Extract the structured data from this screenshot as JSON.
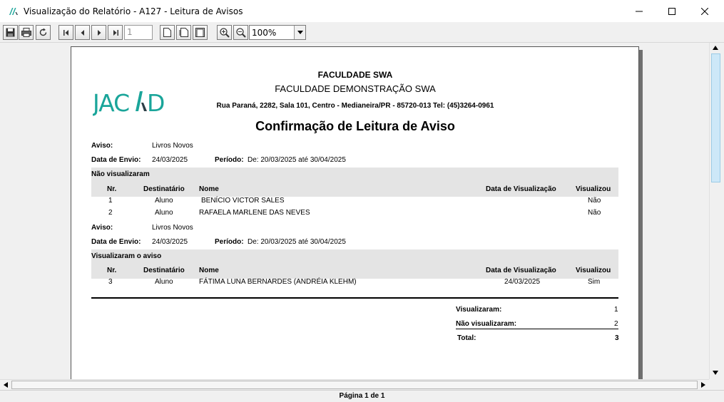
{
  "window": {
    "title": "Visualização do Relatório - A127 - Leitura de Avisos"
  },
  "toolbar": {
    "page_number": "1",
    "zoom": "100%"
  },
  "report": {
    "institution": "FACULDADE SWA",
    "subtitle": "FACULDADE DEMONSTRAÇÃO SWA",
    "address": "Rua Paraná, 2282, Sala 101, Centro - Medianeira/PR - 85720-013 Tel: (45)3264-0961",
    "title": "Confirmação de Leitura de Aviso",
    "logo_text": "JACAD",
    "labels": {
      "aviso": "Aviso:",
      "data_envio": "Data de Envio:",
      "periodo": "Período:"
    },
    "columns": [
      "Nr.",
      "Destinatário",
      "Nome",
      "Data de Visualização",
      "Visualizou"
    ],
    "sections": [
      {
        "aviso": "Livros Novos",
        "data_envio": "24/03/2025",
        "periodo": "De: 20/03/2025 até 30/04/2025",
        "group_title": "Não visualizaram",
        "rows": [
          {
            "nr": "1",
            "destinatario": "Aluno",
            "nome": "BENÍCIO VICTOR SALES",
            "data": "",
            "visualizou": "Não"
          },
          {
            "nr": "2",
            "destinatario": "Aluno",
            "nome": "RAFAELA MARLENE DAS NEVES",
            "data": "",
            "visualizou": "Não"
          }
        ]
      },
      {
        "aviso": "Livros Novos",
        "data_envio": "24/03/2025",
        "periodo": "De: 20/03/2025 até 30/04/2025",
        "group_title": "Visualizaram o aviso",
        "rows": [
          {
            "nr": "3",
            "destinatario": "Aluno",
            "nome": "FÁTIMA LUNA BERNARDES (ANDRÉIA KLEHM)",
            "data": "24/03/2025",
            "visualizou": "Sim"
          }
        ]
      }
    ],
    "summary": {
      "visualizaram_label": "Visualizaram:",
      "visualizaram": "1",
      "nao_visualizaram_label": "Não visualizaram:",
      "nao_visualizaram": "2",
      "total_label": "Total:",
      "total": "3"
    }
  },
  "status": {
    "page_info": "Página 1 de 1"
  },
  "colors": {
    "logo": "#1aa59a",
    "logo_accent": "#2c3e46"
  }
}
